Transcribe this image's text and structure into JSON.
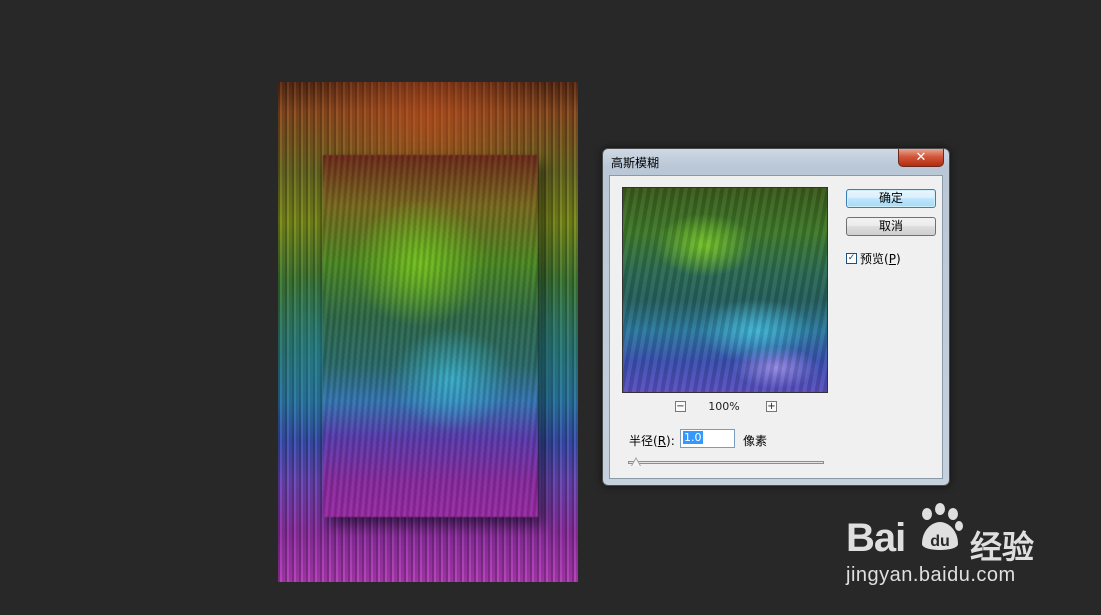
{
  "dialog": {
    "title": "高斯模糊",
    "close_label": "✕",
    "ok_label": "确定",
    "cancel_label": "取消",
    "preview_checkbox": {
      "label_prefix": "预览(",
      "mnemonic": "P",
      "label_suffix": ")",
      "checked": true
    },
    "zoom": {
      "value": "100%",
      "minus": "−",
      "plus": "+"
    },
    "radius": {
      "label_prefix": "半径(",
      "mnemonic": "R",
      "label_suffix": "):",
      "value": "1.0",
      "unit": "像素"
    },
    "slider_fraction": 0.02
  },
  "watermark": {
    "logo_text": "Bai",
    "logo_du": "du",
    "jingyan": "经验",
    "url": "jingyan.baidu.com"
  }
}
